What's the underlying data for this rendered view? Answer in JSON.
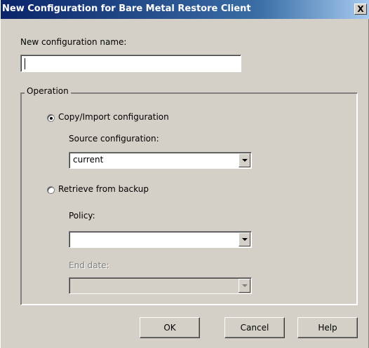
{
  "window": {
    "title": "New Configuration for Bare Metal Restore Client",
    "close_label": "X"
  },
  "name_field": {
    "label": "New configuration name:",
    "value": ""
  },
  "operation": {
    "group_label": "Operation",
    "copy_option": {
      "label": "Copy/Import configuration",
      "selected": true,
      "source_label": "Source configuration:",
      "source_value": "current"
    },
    "retrieve_option": {
      "label": "Retrieve from backup",
      "selected": false,
      "policy_label": "Policy:",
      "policy_value": "",
      "end_date_label": "End date:",
      "end_date_value": ""
    }
  },
  "buttons": {
    "ok": "OK",
    "cancel": "Cancel",
    "help": "Help"
  }
}
